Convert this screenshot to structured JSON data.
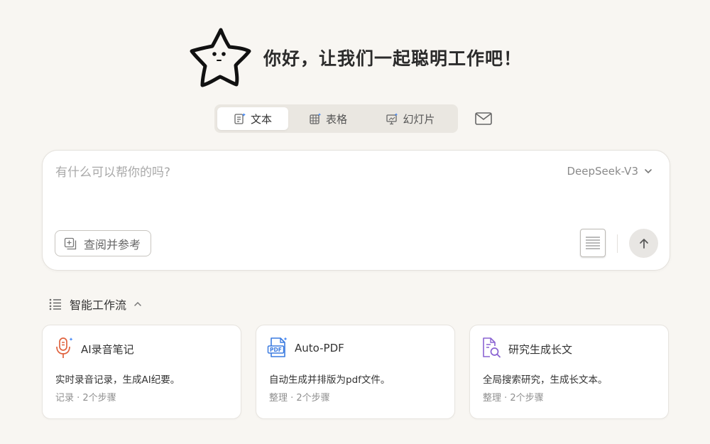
{
  "hero": {
    "title": "你好，让我们一起聪明工作吧！"
  },
  "tabs": [
    {
      "label": "文本",
      "icon": "text-doc-icon",
      "active": true
    },
    {
      "label": "表格",
      "icon": "table-icon",
      "active": false
    },
    {
      "label": "幻灯片",
      "icon": "slides-icon",
      "active": false
    }
  ],
  "mail": {
    "icon": "mail-icon"
  },
  "input": {
    "placeholder": "有什么可以帮你的吗?",
    "value": "",
    "model": "DeepSeek-V3",
    "reference_label": "查阅并参考"
  },
  "workflow": {
    "title": "智能工作流",
    "cards": [
      {
        "title": "AI录音笔记",
        "description": "实时录音记录，生成AI纪要。",
        "meta": "记录 · 2个步骤",
        "icon": "microphone-icon",
        "accent": "#e0633f"
      },
      {
        "title": "Auto-PDF",
        "description": "自动生成并排版为pdf文件。",
        "meta": "整理 · 2个步骤",
        "icon": "pdf-icon",
        "accent": "#3b7be0"
      },
      {
        "title": "研究生成长文",
        "description": "全局搜索研究，生成长文本。",
        "meta": "整理 · 2个步骤",
        "icon": "doc-search-icon",
        "accent": "#8a63d2"
      }
    ]
  },
  "colors": {
    "background": "#f8f6f2",
    "card": "#ffffff",
    "tab_bar": "#eae7e1"
  }
}
